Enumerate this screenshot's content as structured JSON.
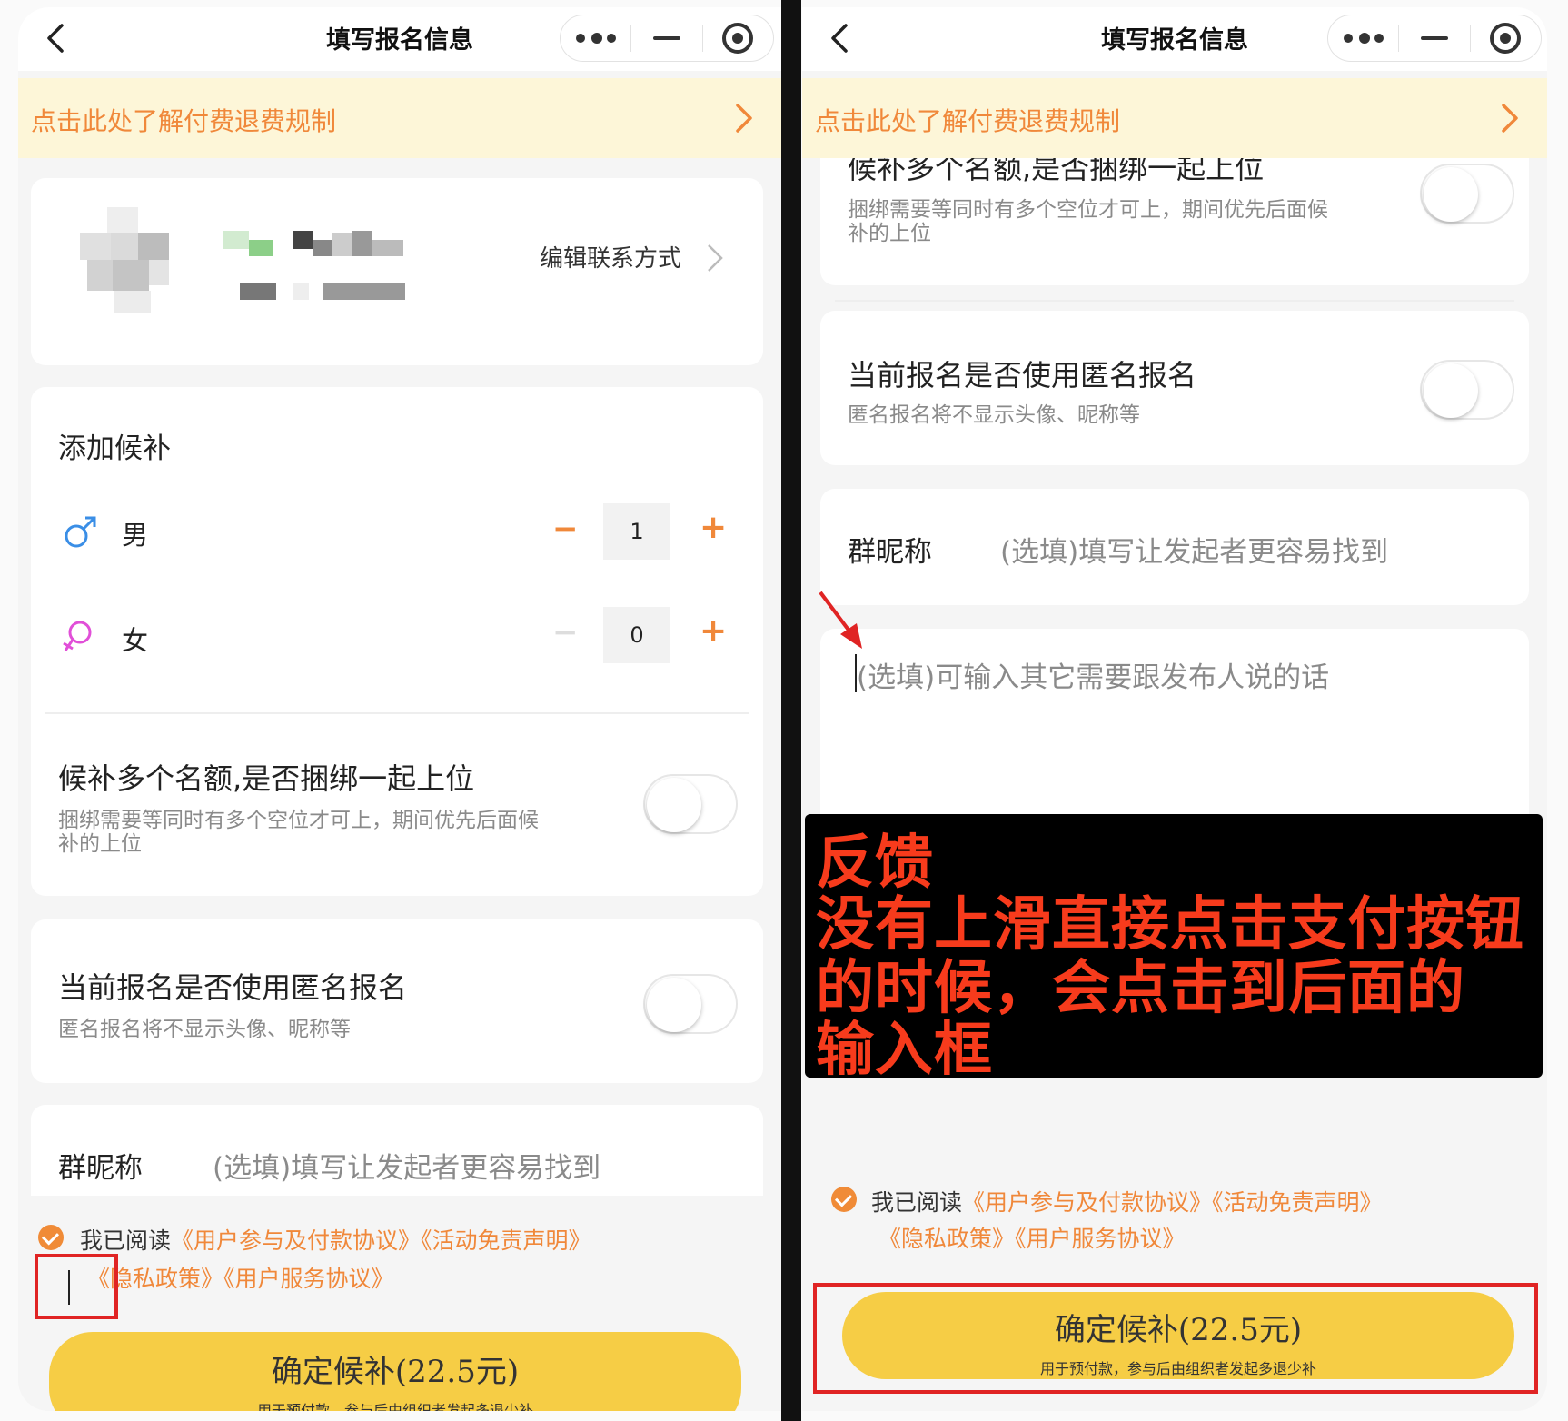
{
  "nav": {
    "title": "填写报名信息"
  },
  "notice": {
    "text": "点击此处了解付费退费规制"
  },
  "contact": {
    "edit_label": "编辑联系方式"
  },
  "waitlist": {
    "title": "添加候补",
    "rows": [
      {
        "label": "男",
        "value": "1",
        "icon": "male-symbol-icon"
      },
      {
        "label": "女",
        "value": "0",
        "icon": "female-symbol-icon"
      }
    ],
    "minus_symbol": "−",
    "plus_symbol": "+"
  },
  "bundle": {
    "title": "候补多个名额,是否捆绑一起上位",
    "desc_line1": "捆绑需要等同时有多个空位才可上，期间优先后面候",
    "desc_line2": "补的上位",
    "enabled": false
  },
  "anonymous": {
    "title": "当前报名是否使用匿名报名",
    "desc": "匿名报名将不显示头像、昵称等",
    "enabled": false
  },
  "nickname": {
    "label": "群昵称",
    "placeholder": "(选填)填写让发起者更容易找到"
  },
  "message": {
    "placeholder": "(选填)可输入其它需要跟发布人说的话"
  },
  "agreement": {
    "prefix": "我已阅读",
    "links": [
      "《用户参与及付款协议》",
      "《活动免责声明》",
      "《隐私政策》",
      "《用户服务协议》"
    ],
    "checked": true
  },
  "confirm": {
    "label": "确定候补(22.5元)",
    "sub": "用于预付款，参与后由组织者发起多退少补"
  },
  "feedback": {
    "line1": "反馈",
    "line2": "没有上滑直接点击支付按钮",
    "line3": "的时候，会点击到后面的",
    "line4": "输入框"
  },
  "colors": {
    "accent": "#f0883a",
    "button": "#f6cd45",
    "notice_bg": "#fdf6d8",
    "annotation_red": "#e02424",
    "feedback_text": "#f73b1c"
  }
}
